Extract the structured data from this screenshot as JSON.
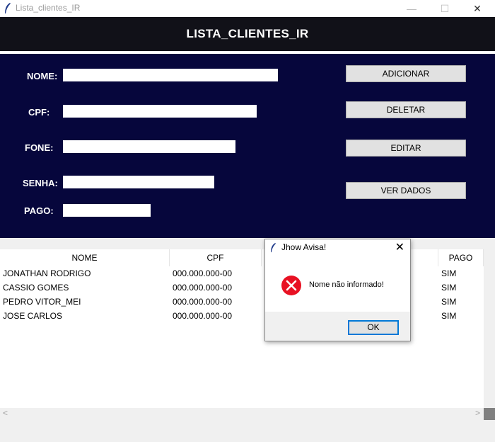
{
  "window": {
    "title": "Lista_clientes_IR",
    "minimize": "—",
    "maximize": "☐",
    "close": "✕"
  },
  "header": {
    "title": "LISTA_CLIENTES_IR"
  },
  "form": {
    "nome_label": "NOME:",
    "nome_value": "",
    "cpf_label": "CPF:",
    "cpf_value": "",
    "fone_label": "FONE:",
    "fone_value": "",
    "senha_label": "SENHA:",
    "senha_value": "",
    "pago_label": "PAGO:",
    "pago_value": ""
  },
  "buttons": {
    "adicionar": "ADICIONAR",
    "deletar": "DELETAR",
    "editar": "EDITAR",
    "ver_dados": "VER DADOS"
  },
  "table": {
    "headers": [
      "NOME",
      "CPF",
      "PAGO"
    ],
    "rows": [
      {
        "nome": "JONATHAN RODRIGO",
        "cpf": "000.000.000-00",
        "pago": "SIM"
      },
      {
        "nome": "CASSIO GOMES",
        "cpf": "000.000.000-00",
        "pago": "SIM"
      },
      {
        "nome": "PEDRO VITOR_MEI",
        "cpf": "000.000.000-00",
        "pago": "SIM"
      },
      {
        "nome": "JOSE CARLOS",
        "cpf": "000.000.000-00",
        "pago": "SIM"
      }
    ]
  },
  "scrollbar": {
    "left_arrow": "<",
    "right_arrow": ">"
  },
  "dialog": {
    "title": "Jhow Avisa!",
    "message": "Nome não informado!",
    "ok": "OK",
    "close": "✕"
  },
  "colors": {
    "panel": "#06063c",
    "header": "#111118",
    "error": "#e81123",
    "focus": "#0078d7"
  }
}
